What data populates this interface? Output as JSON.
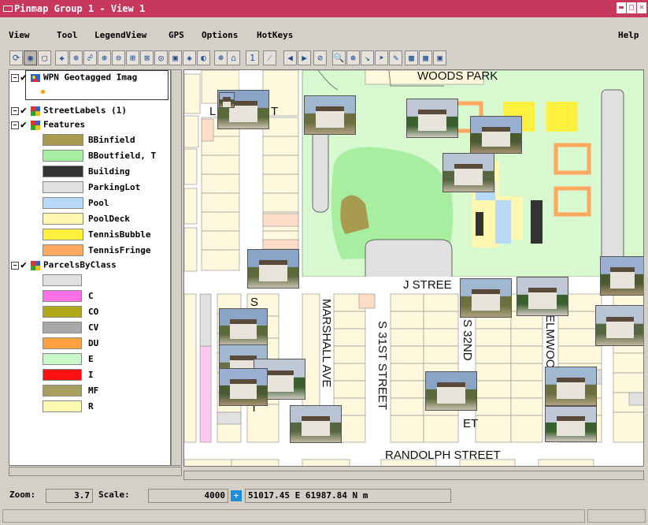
{
  "window": {
    "title": "Pinmap Group 1 - View 1",
    "minimize_glyph": "▬",
    "maximize_glyph": "□",
    "close_glyph": "✕"
  },
  "menu": {
    "view": "View",
    "tool": "Tool",
    "legendview": "LegendView",
    "gps": "GPS",
    "options": "Options",
    "hotkeys": "HotKeys",
    "help": "Help"
  },
  "toolbar": {
    "icons": [
      "zoom-tool-icon",
      "pan-tool-icon",
      "select-rect-icon",
      "add-layer-icon",
      "measure-icon",
      "group-icon",
      "zoom-in-icon",
      "zoom-out-icon",
      "zoom-box-icon",
      "full-extent-icon",
      "target-icon",
      "identify-icon",
      "globe-icon",
      "photo-icon",
      "gps-icon",
      "camera-icon",
      "text-tool-icon",
      "line-tool-icon",
      "back-icon",
      "forward-icon",
      "stop-icon",
      "search-icon",
      "settings-icon",
      "arrow-tool-icon",
      "select-arrow-icon",
      "edit-icon",
      "print-icon",
      "chart-icon",
      "stop-square-icon"
    ],
    "glyphs": [
      "⟳",
      "◉",
      "▢",
      "✚",
      "⊕",
      "☍",
      "⊕",
      "⊖",
      "⊞",
      "⊠",
      "◎",
      "▣",
      "◈",
      "◐",
      "☸",
      "⌂",
      "1",
      "⁄",
      "◀",
      "▶",
      "⊘",
      "🔍",
      "⊛",
      "↘",
      "➤",
      "✎",
      "▩",
      "▦",
      "▣"
    ]
  },
  "legend": {
    "layers": [
      {
        "name": "WPN Geotagged Imag",
        "icon": "gps-photo-icon",
        "checked": true
      },
      {
        "name": "StreetLabels (1)",
        "icon": "street-labels-icon",
        "checked": true
      },
      {
        "name": "Features",
        "icon": "features-icon",
        "checked": true
      },
      {
        "name": "ParcelsByClass",
        "icon": "parcels-icon",
        "checked": true
      }
    ],
    "features": [
      {
        "label": "BBinfield",
        "color": "#a89a4f"
      },
      {
        "label": "BBoutfield, T",
        "color": "#a8eea0"
      },
      {
        "label": "Building",
        "color": "#333333"
      },
      {
        "label": "ParkingLot",
        "color": "#e0e0e0"
      },
      {
        "label": "Pool",
        "color": "#b8d8f8"
      },
      {
        "label": "PoolDeck",
        "color": "#fff6b0"
      },
      {
        "label": "TennisBubble",
        "color": "#fff040"
      },
      {
        "label": "TennisFringe",
        "color": "#ffa860"
      }
    ],
    "parcels": [
      {
        "label": "",
        "color": "#e0e0e0"
      },
      {
        "label": "C",
        "color": "#ff70e8"
      },
      {
        "label": "CO",
        "color": "#b0a818"
      },
      {
        "label": "CV",
        "color": "#a8a8a8"
      },
      {
        "label": "DU",
        "color": "#ffa040"
      },
      {
        "label": "E",
        "color": "#c8f8c8"
      },
      {
        "label": "I",
        "color": "#ff1010"
      },
      {
        "label": "MF",
        "color": "#a8a060"
      },
      {
        "label": "R",
        "color": "#fff8b0"
      }
    ]
  },
  "map": {
    "labels": {
      "woods_park": "WOODS PARK",
      "j_street": "J STREE",
      "randolph": "RANDOLPH STREET",
      "marshall": "MARSHALL AVE",
      "s31": "S 31ST STREET",
      "s32": "S 32ND",
      "elmwood": "ELMWOO",
      "l_label": "L",
      "t_label": "T",
      "s_label": "S",
      "t2_label": "T",
      "et_label": "ET"
    },
    "photo_count": 22
  },
  "status": {
    "zoom_label": "Zoom:",
    "zoom_value": "3.7",
    "scale_label": "Scale:",
    "scale_value": "4000",
    "coords": "51017.45 E  61987.84 N m"
  },
  "colors": {
    "titlebar": "#c8385c",
    "park": "#d8f8d0",
    "field": "#a8eea0",
    "parcel": "#fff8dc"
  }
}
